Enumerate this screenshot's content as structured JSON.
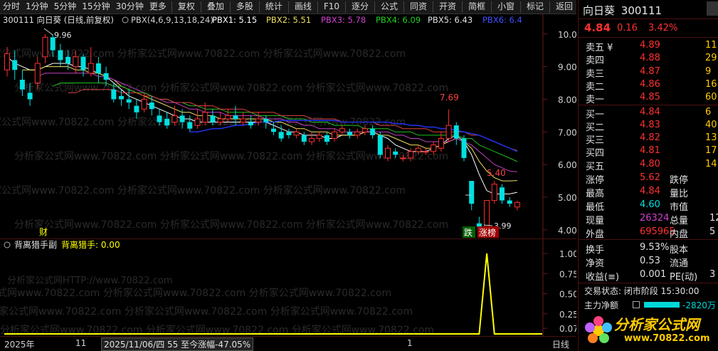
{
  "toolbar": {
    "periods": [
      "分时",
      "1分钟",
      "5分钟",
      "15分钟",
      "30分钟",
      "更多"
    ],
    "actions": [
      "复权",
      "叠加",
      "多股",
      "统计",
      "画线",
      "F10",
      "逐分",
      "公式",
      "同资",
      "开资",
      "简框",
      "小窗",
      "标记",
      "返回"
    ]
  },
  "main": {
    "header": {
      "code_name": "300111 向日葵 (日线,前复权)",
      "indicator": "PBX(4,6,9,13,18,24)",
      "pbx1": "PBX1: 5.15",
      "pbx2": "PBX2: 5.51",
      "pbx3": "PBX3: 5.78",
      "pbx4": "PBX4: 6.09",
      "pbx5": "PBX5: 6.43",
      "pbx6": "PBX6: 6.4"
    },
    "annotations": {
      "high_label": "9.96",
      "peak_label": "7.69",
      "recent_label": "5.40",
      "low_label": "3.99",
      "cai_tag": "财",
      "die_tag": "跌",
      "zhang_tag": "涨榜"
    },
    "y_ticks": [
      "10.00",
      "9.00",
      "8.00",
      "7.00",
      "6.00",
      "5.00",
      "4.00"
    ],
    "watermark": "分析家公式网www.70822.com"
  },
  "sub": {
    "title": "背离猎手副",
    "label": "背离猎手: 0.00",
    "y_ticks": [
      "1.00",
      "0.75",
      "0.50",
      "0.25",
      "0.07"
    ],
    "watermark_http": "分析家公式网HTTP://www.70822.com"
  },
  "datebar": {
    "year": "2025年",
    "month": "11",
    "info": "2025/11/06/四 55 至今涨幅-47.05%",
    "tick": "1",
    "right": "日线"
  },
  "panel": {
    "name": "向日葵",
    "code": "300111",
    "price": "4.84",
    "change": "0.16",
    "pct": "3.42%",
    "asks": [
      {
        "label": "卖五 ¥",
        "price": "4.89",
        "vol": "11"
      },
      {
        "label": "卖四",
        "price": "4.88",
        "vol": "29"
      },
      {
        "label": "卖三",
        "price": "4.87",
        "vol": "9"
      },
      {
        "label": "卖二",
        "price": "4.86",
        "vol": "16"
      },
      {
        "label": "卖一",
        "price": "4.85",
        "vol": "60"
      }
    ],
    "bids": [
      {
        "label": "买一",
        "price": "4.84",
        "vol": "6"
      },
      {
        "label": "买二",
        "price": "4.83",
        "vol": "40"
      },
      {
        "label": "买三",
        "price": "4.82",
        "vol": "13"
      },
      {
        "label": "买四",
        "price": "4.81",
        "vol": "17"
      },
      {
        "label": "买五",
        "price": "4.80",
        "vol": "14"
      }
    ],
    "stats": [
      {
        "l": "涨停",
        "v": "5.62",
        "l2": "跌停"
      },
      {
        "l": "最高",
        "v": "4.84",
        "l2": "量比"
      },
      {
        "l": "最低",
        "v": "4.60",
        "l2": "市值"
      },
      {
        "l": "现量",
        "v": "26324",
        "l2": "总量",
        "v2": "12"
      },
      {
        "l": "外盘",
        "v": "695965",
        "l2": "内盘",
        "v2": "5"
      }
    ],
    "stats2": [
      {
        "l": "换手",
        "v": "9.53%",
        "l2": "股本"
      },
      {
        "l": "净资",
        "v": "0.53",
        "l2": "流通"
      },
      {
        "l": "收益(≡)",
        "v": "0.001",
        "l2": "PE(动)",
        "v2": "3"
      }
    ],
    "trade_state": "交易状态: 闭市阶段 15:30:00",
    "main_net_label": "主力净额",
    "main_net_value": "-2820万",
    "logo_text": "分析家公式网",
    "logo_url": "www.70822.com"
  },
  "chart_data": {
    "type": "candlestick",
    "ylim": [
      3.8,
      10.3
    ],
    "candles": [
      [
        8.9,
        9.4,
        9.6,
        8.7
      ],
      [
        9.2,
        8.9,
        9.5,
        8.6
      ],
      [
        8.6,
        8.3,
        8.9,
        8.1
      ],
      [
        8.2,
        8.0,
        8.5,
        7.8
      ],
      [
        8.5,
        9.1,
        9.3,
        8.3
      ],
      [
        9.3,
        9.9,
        10.0,
        9.1
      ],
      [
        9.9,
        9.5,
        10.0,
        9.3
      ],
      [
        9.5,
        9.2,
        9.7,
        9.0
      ],
      [
        9.3,
        9.1,
        9.5,
        8.9
      ],
      [
        9.0,
        9.3,
        9.5,
        8.8
      ],
      [
        9.3,
        8.9,
        9.4,
        8.7
      ],
      [
        8.8,
        9.1,
        9.6,
        8.7
      ],
      [
        9.1,
        8.8,
        9.3,
        8.5
      ],
      [
        8.8,
        8.6,
        9.0,
        8.4
      ],
      [
        8.3,
        8.0,
        8.5,
        7.9
      ],
      [
        8.1,
        8.0,
        8.3,
        7.8
      ],
      [
        8.0,
        7.9,
        8.3,
        7.7
      ],
      [
        7.8,
        7.6,
        8.0,
        7.4
      ],
      [
        7.7,
        8.0,
        8.2,
        7.6
      ],
      [
        7.9,
        7.7,
        8.1,
        7.5
      ],
      [
        7.5,
        7.3,
        7.7,
        7.2
      ],
      [
        7.4,
        7.2,
        7.6,
        7.1
      ],
      [
        7.3,
        7.5,
        7.8,
        7.2
      ],
      [
        7.5,
        7.3,
        7.7,
        7.1
      ],
      [
        7.3,
        7.1,
        7.5,
        7.0
      ],
      [
        7.2,
        7.4,
        7.7,
        7.1
      ],
      [
        7.3,
        7.6,
        7.9,
        7.2
      ],
      [
        7.5,
        7.3,
        7.7,
        7.2
      ],
      [
        7.3,
        7.4,
        7.6,
        7.2
      ],
      [
        7.4,
        7.5,
        7.7,
        7.3
      ],
      [
        7.5,
        7.4,
        7.8,
        7.2
      ],
      [
        7.3,
        7.4,
        7.6,
        7.2
      ],
      [
        7.3,
        7.2,
        7.5,
        7.1
      ],
      [
        7.3,
        7.4,
        7.6,
        7.2
      ],
      [
        7.4,
        7.3,
        7.5,
        7.1
      ],
      [
        7.1,
        7.0,
        7.3,
        6.9
      ],
      [
        7.0,
        6.8,
        7.2,
        6.7
      ],
      [
        7.0,
        6.9,
        7.1,
        6.8
      ],
      [
        6.9,
        7.0,
        7.1,
        6.8
      ],
      [
        6.9,
        6.7,
        7.0,
        6.6
      ],
      [
        6.7,
        6.8,
        7.0,
        6.6
      ],
      [
        6.8,
        6.9,
        7.0,
        6.7
      ],
      [
        6.9,
        6.7,
        7.0,
        6.6
      ],
      [
        6.8,
        7.0,
        7.1,
        6.7
      ],
      [
        7.0,
        7.1,
        7.2,
        6.9
      ],
      [
        7.0,
        6.9,
        7.1,
        6.8
      ],
      [
        6.9,
        7.0,
        7.1,
        6.8
      ],
      [
        7.0,
        7.1,
        7.2,
        6.9
      ],
      [
        7.1,
        6.9,
        7.2,
        6.8
      ],
      [
        6.9,
        6.3,
        7.0,
        6.2
      ],
      [
        6.2,
        6.5,
        6.6,
        6.1
      ],
      [
        6.4,
        6.3,
        6.5,
        6.2
      ],
      [
        6.2,
        6.2,
        6.3,
        6.1
      ],
      [
        6.2,
        6.4,
        6.5,
        6.1
      ],
      [
        6.4,
        6.5,
        6.6,
        6.3
      ],
      [
        6.4,
        6.4,
        6.5,
        6.3
      ],
      [
        6.4,
        6.6,
        6.7,
        6.3
      ],
      [
        6.5,
        6.8,
        7.0,
        6.4
      ],
      [
        6.8,
        7.2,
        7.69,
        6.7
      ],
      [
        7.2,
        6.8,
        7.3,
        6.6
      ],
      [
        6.8,
        6.2,
        6.9,
        6.1
      ],
      [
        5.5,
        4.8,
        5.4,
        4.6
      ],
      [
        4.2,
        4.1,
        4.4,
        3.99
      ],
      [
        4.1,
        4.9,
        4.9,
        4.0
      ],
      [
        4.9,
        5.4,
        5.5,
        4.8
      ],
      [
        5.3,
        4.9,
        5.4,
        4.8
      ],
      [
        4.9,
        4.8,
        5.0,
        4.7
      ],
      [
        4.7,
        4.84,
        4.9,
        4.6
      ]
    ],
    "ma_lines": [
      {
        "name": "PBX1",
        "color": "#ffffff",
        "values": [
          9.3,
          9.1,
          9.0,
          8.9,
          8.9,
          9.0,
          9.1,
          9.1,
          9.1,
          9.0,
          9.0,
          8.9,
          8.8,
          8.7,
          8.5,
          8.3,
          8.1,
          8.0,
          7.9,
          7.8,
          7.7,
          7.6,
          7.5,
          7.4,
          7.4,
          7.3,
          7.3,
          7.3,
          7.3,
          7.3,
          7.3,
          7.3,
          7.3,
          7.3,
          7.3,
          7.2,
          7.1,
          7.0,
          7.0,
          6.9,
          6.9,
          6.9,
          6.8,
          6.8,
          6.9,
          6.9,
          6.9,
          7.0,
          7.0,
          6.9,
          6.8,
          6.6,
          6.5,
          6.4,
          6.4,
          6.4,
          6.5,
          6.6,
          6.8,
          6.9,
          6.7,
          6.3,
          5.7,
          5.2,
          5.1,
          5.1,
          5.1,
          5.15
        ]
      },
      {
        "name": "PBX2",
        "color": "#f0e060",
        "values": [
          null,
          null,
          8.9,
          8.9,
          8.9,
          9.0,
          9.0,
          9.0,
          9.0,
          8.9,
          8.9,
          8.8,
          8.8,
          8.7,
          8.6,
          8.4,
          8.3,
          8.2,
          8.1,
          8.0,
          7.9,
          7.8,
          7.7,
          7.6,
          7.6,
          7.5,
          7.5,
          7.5,
          7.4,
          7.4,
          7.4,
          7.4,
          7.4,
          7.4,
          7.4,
          7.3,
          7.3,
          7.2,
          7.1,
          7.1,
          7.0,
          7.0,
          7.0,
          6.9,
          6.9,
          6.9,
          6.9,
          7.0,
          7.0,
          6.9,
          6.9,
          6.8,
          6.7,
          6.6,
          6.6,
          6.5,
          6.5,
          6.6,
          6.7,
          6.8,
          6.7,
          6.5,
          6.1,
          5.8,
          5.6,
          5.5,
          5.5,
          5.51
        ]
      },
      {
        "name": "PBX3",
        "color": "#c040c0",
        "values": [
          null,
          null,
          null,
          null,
          8.7,
          8.8,
          8.8,
          8.8,
          8.8,
          8.8,
          8.8,
          8.8,
          8.7,
          8.7,
          8.6,
          8.5,
          8.4,
          8.3,
          8.2,
          8.1,
          8.0,
          7.9,
          7.9,
          7.8,
          7.7,
          7.7,
          7.6,
          7.6,
          7.6,
          7.5,
          7.5,
          7.5,
          7.5,
          7.5,
          7.4,
          7.4,
          7.4,
          7.3,
          7.3,
          7.2,
          7.2,
          7.1,
          7.1,
          7.1,
          7.0,
          7.0,
          7.0,
          7.0,
          7.0,
          7.0,
          7.0,
          6.9,
          6.9,
          6.8,
          6.8,
          6.7,
          6.7,
          6.7,
          6.7,
          6.8,
          6.7,
          6.6,
          6.4,
          6.2,
          6.0,
          5.9,
          5.8,
          5.78
        ]
      },
      {
        "name": "PBX4",
        "color": "#20c020",
        "values": [
          null,
          null,
          null,
          null,
          null,
          null,
          8.4,
          8.5,
          8.5,
          8.5,
          8.5,
          8.5,
          8.5,
          8.5,
          8.4,
          8.4,
          8.3,
          8.2,
          8.2,
          8.1,
          8.0,
          8.0,
          7.9,
          7.9,
          7.8,
          7.8,
          7.7,
          7.7,
          7.7,
          7.6,
          7.6,
          7.6,
          7.6,
          7.5,
          7.5,
          7.5,
          7.5,
          7.4,
          7.4,
          7.4,
          7.3,
          7.3,
          7.3,
          7.2,
          7.2,
          7.2,
          7.2,
          7.1,
          7.1,
          7.1,
          7.1,
          7.0,
          7.0,
          7.0,
          6.9,
          6.9,
          6.9,
          6.9,
          6.9,
          6.9,
          6.8,
          6.8,
          6.6,
          6.5,
          6.4,
          6.3,
          6.2,
          6.09
        ]
      },
      {
        "name": "PBX5",
        "color": "#e04040",
        "values": [
          null,
          null,
          null,
          null,
          null,
          null,
          null,
          null,
          8.2,
          8.2,
          8.3,
          8.3,
          8.3,
          8.3,
          8.3,
          8.2,
          8.2,
          8.2,
          8.1,
          8.1,
          8.0,
          8.0,
          7.9,
          7.9,
          7.9,
          7.8,
          7.8,
          7.8,
          7.7,
          7.7,
          7.7,
          7.7,
          7.6,
          7.6,
          7.6,
          7.6,
          7.5,
          7.5,
          7.5,
          7.5,
          7.4,
          7.4,
          7.4,
          7.4,
          7.3,
          7.3,
          7.3,
          7.3,
          7.3,
          7.2,
          7.2,
          7.2,
          7.1,
          7.1,
          7.1,
          7.1,
          7.0,
          7.0,
          7.0,
          7.0,
          7.0,
          6.9,
          6.9,
          6.8,
          6.7,
          6.6,
          6.5,
          6.43
        ]
      },
      {
        "name": "PBX6",
        "color": "#2030e0",
        "values": [
          null,
          null,
          null,
          null,
          null,
          null,
          null,
          null,
          null,
          null,
          null,
          null,
          null,
          null,
          null,
          null,
          null,
          null,
          null,
          null,
          null,
          null,
          null,
          null,
          7.0,
          7.0,
          7.05,
          7.1,
          7.1,
          7.15,
          7.2,
          7.2,
          7.25,
          7.3,
          7.3,
          7.3,
          7.35,
          7.35,
          7.35,
          7.35,
          7.35,
          7.35,
          7.35,
          7.35,
          7.3,
          7.3,
          7.3,
          7.3,
          7.3,
          7.3,
          7.3,
          7.25,
          7.25,
          7.2,
          7.2,
          7.15,
          7.15,
          7.1,
          7.1,
          7.05,
          7.0,
          6.95,
          6.9,
          6.8,
          6.7,
          6.6,
          6.5,
          6.4
        ]
      }
    ],
    "sub_series": {
      "name": "背离猎手",
      "values": [
        0,
        0,
        0,
        0,
        0,
        0,
        0,
        0,
        0,
        0,
        0,
        0,
        0,
        0,
        0,
        0,
        0,
        0,
        0,
        0,
        0,
        0,
        0,
        0,
        0,
        0,
        0,
        0,
        0,
        0,
        0,
        0,
        0,
        0,
        0,
        0,
        0,
        0,
        0,
        0,
        0,
        0,
        0,
        0,
        0,
        0,
        0,
        0,
        0,
        0,
        0,
        0,
        0,
        0,
        0,
        0,
        0,
        0,
        0,
        0,
        0,
        0,
        0,
        1,
        0,
        0,
        0,
        0
      ]
    }
  }
}
